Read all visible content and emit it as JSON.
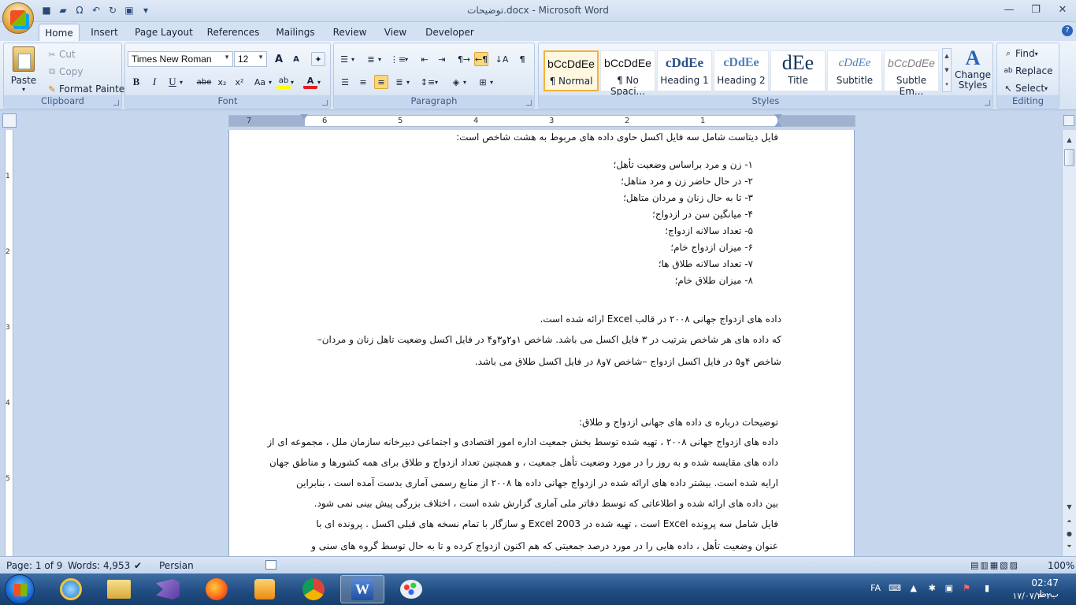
{
  "window": {
    "title": "توضیحات.docx - Microsoft Word"
  },
  "quick_access": {
    "save_icon": "save-icon",
    "open_icon": "open-icon",
    "symbol_icon": "omega-icon",
    "undo_icon": "undo-icon",
    "redo_icon": "redo-icon",
    "print_icon": "print-preview-icon"
  },
  "tabs": [
    "Home",
    "Insert",
    "Page Layout",
    "References",
    "Mailings",
    "Review",
    "View",
    "Developer"
  ],
  "ribbon": {
    "clipboard": {
      "label": "Clipboard",
      "paste": "Paste",
      "cut": "Cut",
      "copy": "Copy",
      "format_painter": "Format Painter"
    },
    "font": {
      "label": "Font",
      "family": "Times New Roman",
      "size": "12",
      "grow": "A",
      "shrink": "A",
      "bold": "B",
      "italic": "I",
      "underline": "U",
      "strike": "abe",
      "subscript": "x₂",
      "superscript": "x²",
      "change_case": "Aa",
      "font_color": "A"
    },
    "paragraph": {
      "label": "Paragraph"
    },
    "styles": {
      "label": "Styles",
      "items": [
        {
          "preview": "bCcDdEe",
          "name": "¶ Normal"
        },
        {
          "preview": "bCcDdEe",
          "name": "¶ No Spaci..."
        },
        {
          "preview": "cDdEe",
          "name": "Heading 1"
        },
        {
          "preview": "cDdEe",
          "name": "Heading 2"
        },
        {
          "preview": "dEe",
          "name": "Title"
        },
        {
          "preview": "cDdEe",
          "name": "Subtitle"
        },
        {
          "preview": "bCcDdEe",
          "name": "Subtle Em..."
        }
      ],
      "change_styles": "Change Styles"
    },
    "editing": {
      "label": "Editing",
      "find": "Find",
      "replace": "Replace",
      "select": "Select"
    }
  },
  "ruler": {
    "numbers": [
      "7",
      "6",
      "5",
      "4",
      "3",
      "2",
      "1"
    ]
  },
  "vruler": {
    "numbers": [
      "1",
      "2",
      "3",
      "4",
      "5"
    ]
  },
  "document": {
    "intro": "فایل دیتاست شامل سه فایل اکسل حاوی داده های مربوط به هشت شاخص است:",
    "list": [
      "۱-  زن و مرد براساس وضعیت تأهل؛",
      "۲-  در حال حاضر زن و مرد متاهل؛",
      "۳-  تا به حال زنان و مردان متاهل؛",
      "۴-  میانگین سن در ازدواج؛",
      "۵-  تعداد سالانه ازدواج؛",
      "۶-  میزان ازدواج خام؛",
      "۷-  تعداد سالانه طلاق ها؛",
      "۸-  میزان طلاق خام؛"
    ],
    "para1": "داده های ازدواج جهانی ۲۰۰۸  در قالب Excel ارائه شده است.",
    "para2a": "که داده های هر شاخص بترتیب در ۳ فایل اکسل می باشد. شاخص ۱و۲و۳و۴ در فایل اکسل وضعیت تاهل زنان و مردان–",
    "para2b": "شاخص ۴و۵ در فایل اکسل ازدواج –شاخص ۷و۸ در فایل اکسل طلاق می باشد.",
    "heading2": "توضیحات درباره ی  داده های جهانی ازدواج و طلاق:",
    "body": [
      "داده های ازدواج جهانی ۲۰۰۸ ، تهیه شده توسط بخش جمعیت اداره امور اقتصادی و اجتماعی دبیرخانه سازمان ملل ، مجموعه ای از",
      "داده های مقایسه شده و به روز را در مورد وضعیت تأهل جمعیت ، و همچنین تعداد  ازدواج و طلاق برای همه کشورها و مناطق جهان",
      "ارایه شده است. بیشتر داده های ارائه شده در ازدواج جهانی داده ها ۲۰۰۸ از منابع رسمی آماری بدست آمده است ، بنابراین",
      "بین داده های ارائه شده و اطلاعاتی که توسط دفاتر ملی آماری گزارش شده است ، اختلاف بزرگی پیش بینی نمی شود.",
      "فایل شامل سه پرونده Excel است ، تهیه شده در 2003 Excel و سازگار با تمام نسخه های قبلی اکسل . پرونده ای با",
      "عنوان وضعیت تأهل ، داده هایی را در مورد درصد جمعیتی که هم اکنون ازدواج کرده و تا به حال توسط گروه های سنی و"
    ]
  },
  "status": {
    "page": "Page: 1 of 9",
    "words": "Words: 4,953",
    "language": "Persian",
    "zoom": "100%"
  },
  "taskbar": {
    "lang": "FA",
    "time": "02:47 ب.ظ",
    "date": "۱۷/۰۷/۲۰۲۰"
  }
}
